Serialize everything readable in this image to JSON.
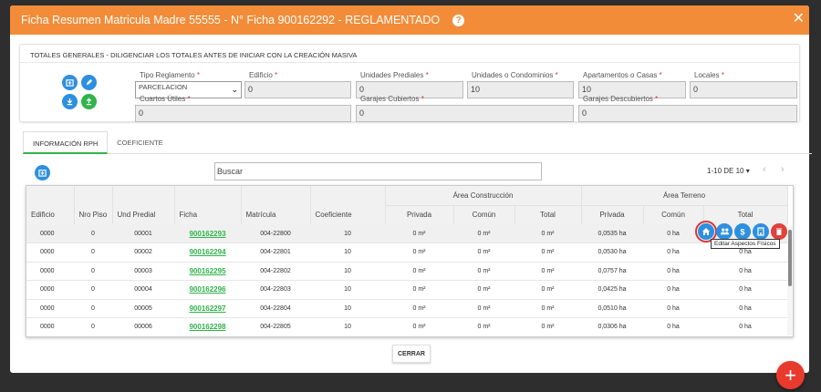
{
  "modal": {
    "title": "Ficha Resumen Matricula Madre 55555 - N° Ficha 900162292 - REGLAMENTADO",
    "help": "?",
    "close": "✕"
  },
  "totals": {
    "heading": "TOTALES GENERALES - DILIGENCIAR LOS TOTALES ANTES DE INICIAR CON LA CREACIÓN MASIVA",
    "fields": [
      {
        "label": "Tipo Reglamento",
        "value": "PARCELACION"
      },
      {
        "label": "Edificio",
        "value": "0"
      },
      {
        "label": "Unidades Prediales",
        "value": "0"
      },
      {
        "label": "Unidades o Condominios",
        "value": "10"
      },
      {
        "label": "Apartamentos o Casas",
        "value": "10"
      },
      {
        "label": "Locales",
        "value": "0"
      },
      {
        "label": "Cuartos Útiles",
        "value": "0"
      },
      {
        "label": "Garajes Cubiertos",
        "value": "0"
      },
      {
        "label": "Garajes Descubiertos",
        "value": "0"
      }
    ],
    "required_mark": "*"
  },
  "tabs": [
    {
      "label": "INFORMACIÓN RPH",
      "active": true
    },
    {
      "label": "COEFICIENTE",
      "active": false
    }
  ],
  "toolbar": {
    "search_placeholder": "Buscar",
    "pager_text": "1-10 DE 10 ▾",
    "prev": "‹",
    "next": "›"
  },
  "table": {
    "group_headers": {
      "construccion": "Área Construcción",
      "terreno": "Área Terreno"
    },
    "columns": [
      "Edificio",
      "Nro Piso",
      "Und Predial",
      "Ficha",
      "Matrícula",
      "Coeficiente",
      "Privada",
      "Común",
      "Total",
      "Privada",
      "Común",
      "Total"
    ],
    "rows": [
      [
        "0000",
        "0",
        "00001",
        "900162293",
        "004-22800",
        "10",
        "0 m²",
        "0 m²",
        "0 m²",
        "0,0535 ha",
        "0 ha",
        ""
      ],
      [
        "0000",
        "0",
        "00002",
        "900162294",
        "004-22801",
        "10",
        "0 m²",
        "0 m²",
        "0 m²",
        "0,0530 ha",
        "0 ha",
        "0 ha"
      ],
      [
        "0000",
        "0",
        "00003",
        "900162295",
        "004-22802",
        "10",
        "0 m²",
        "0 m²",
        "0 m²",
        "0,0757 ha",
        "0 ha",
        "0 ha"
      ],
      [
        "0000",
        "0",
        "00004",
        "900162296",
        "004-22803",
        "10",
        "0 m²",
        "0 m²",
        "0 m²",
        "0,0425 ha",
        "0 ha",
        "0 ha"
      ],
      [
        "0000",
        "0",
        "00005",
        "900162297",
        "004-22804",
        "10",
        "0 m²",
        "0 m²",
        "0 m²",
        "0,0510 ha",
        "0 ha",
        "0 ha"
      ],
      [
        "0000",
        "0",
        "00006",
        "900162298",
        "004-22805",
        "10",
        "0 m²",
        "0 m²",
        "0 m²",
        "0,0306 ha",
        "0 ha",
        "0 ha"
      ]
    ]
  },
  "row_actions": {
    "icons": [
      "home-icon",
      "people-icon",
      "dollar-icon",
      "building-icon",
      "trash-icon"
    ],
    "tooltip": "Editar Aspectos Físicos"
  },
  "footer": {
    "close_label": "CERRAR"
  },
  "fab": {
    "label": "+"
  },
  "colors": {
    "header": "#f28c38",
    "accent_blue": "#2d8fe0",
    "accent_green": "#2fb44a",
    "danger": "#e0413a"
  }
}
